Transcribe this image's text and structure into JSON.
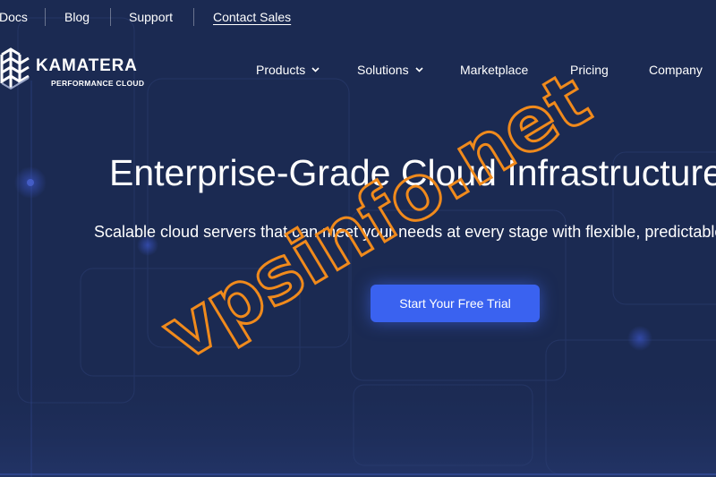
{
  "topbar": {
    "links": [
      {
        "label": "Docs"
      },
      {
        "label": "Blog"
      },
      {
        "label": "Support"
      },
      {
        "label": "Contact Sales"
      }
    ]
  },
  "logo": {
    "name": "KAMATERA",
    "tagline": "PERFORMANCE CLOUD"
  },
  "nav": {
    "items": [
      {
        "label": "Products"
      },
      {
        "label": "Solutions"
      },
      {
        "label": "Marketplace"
      },
      {
        "label": "Pricing"
      },
      {
        "label": "Company"
      }
    ]
  },
  "hero": {
    "title": "Enterprise-Grade Cloud Infrastructure",
    "subtitle": "Scalable cloud servers that can meet your needs at every stage with flexible, predictable pricing",
    "cta_label": "Start Your Free Trial"
  },
  "watermark": {
    "text": "vpsinfo.net",
    "color": "#f08a1c"
  },
  "colors": {
    "background": "#1b2a52",
    "accent": "#3a62f0"
  }
}
